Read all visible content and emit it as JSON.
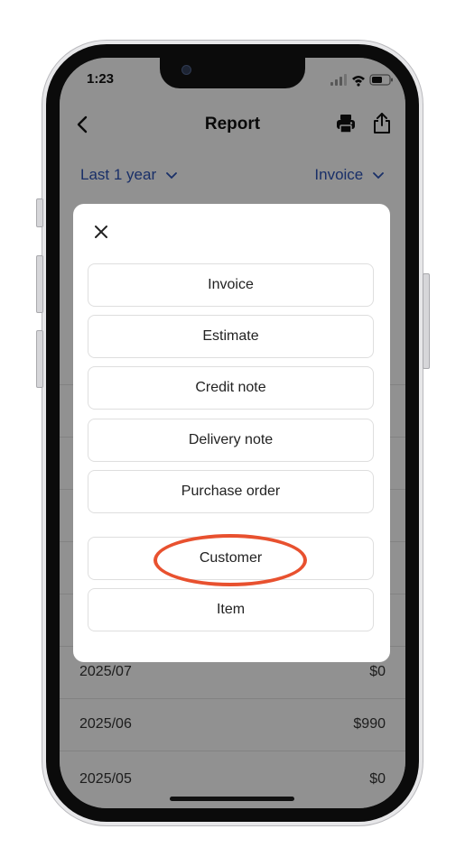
{
  "status_bar": {
    "time": "1:23"
  },
  "header": {
    "title": "Report",
    "back_icon": "chevron-left-icon",
    "print_icon": "printer-icon",
    "share_icon": "share-icon"
  },
  "filters": {
    "period": "Last 1 year",
    "doc_type": "Invoice"
  },
  "report_rows": [
    {
      "date": "2025/07",
      "amount": "$0"
    },
    {
      "date": "2025/06",
      "amount": "$990"
    },
    {
      "date": "2025/05",
      "amount": "$0"
    }
  ],
  "modal": {
    "close_icon": "close-icon",
    "options": [
      "Invoice",
      "Estimate",
      "Credit note",
      "Delivery note",
      "Purchase order"
    ],
    "group_options": [
      "Customer",
      "Item"
    ]
  },
  "colors": {
    "accent": "#2c54b8",
    "highlight": "#e8512f"
  }
}
